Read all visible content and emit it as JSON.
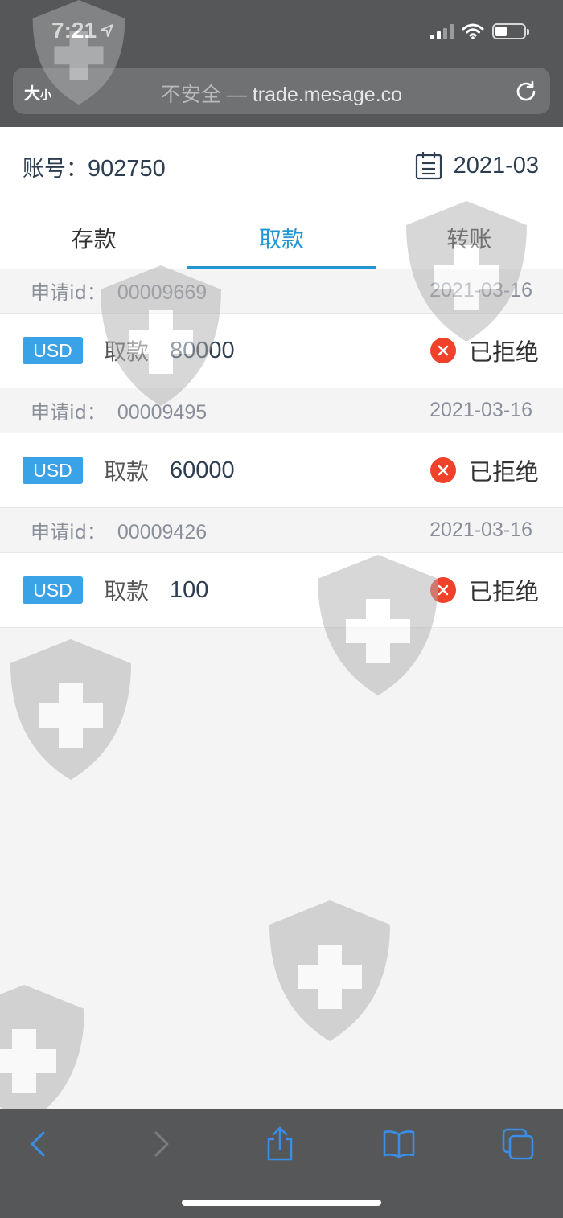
{
  "status_bar": {
    "time": "7:21",
    "location_icon": "location-arrow-icon",
    "signal_icon": "cellular-signal-icon",
    "wifi_icon": "wifi-icon",
    "battery_icon": "battery-icon"
  },
  "browser": {
    "reader_label": "大",
    "reader_label_small": "小",
    "security_text": "不安全",
    "separator": " — ",
    "domain": "trade.mesage.co",
    "reload_icon": "reload-icon"
  },
  "header": {
    "account_label": "账号：",
    "account_number": "902750",
    "calendar_icon": "calendar-icon",
    "month": "2021-03"
  },
  "tabs": [
    {
      "label": "存款",
      "active": false
    },
    {
      "label": "取款",
      "active": true
    },
    {
      "label": "转账",
      "active": false
    }
  ],
  "requests": [
    {
      "id_label": "申请id：",
      "id": "00009669",
      "date": "2021-03-16",
      "currency": "USD",
      "type": "取款",
      "amount": "80000",
      "status": "已拒绝"
    },
    {
      "id_label": "申请id：",
      "id": "00009495",
      "date": "2021-03-16",
      "currency": "USD",
      "type": "取款",
      "amount": "60000",
      "status": "已拒绝"
    },
    {
      "id_label": "申请id：",
      "id": "00009426",
      "date": "2021-03-16",
      "currency": "USD",
      "type": "取款",
      "amount": "100",
      "status": "已拒绝"
    }
  ],
  "toolbar": {
    "back_icon": "back-chevron-icon",
    "forward_icon": "forward-chevron-icon",
    "share_icon": "share-icon",
    "bookmarks_icon": "bookmarks-book-icon",
    "tabs_icon": "tabs-icon"
  },
  "colors": {
    "accent": "#2196d3",
    "badge": "#3aa3e8",
    "reject": "#f0412a",
    "toolbar_icon": "#3a8ee6",
    "chrome": "#555759"
  }
}
